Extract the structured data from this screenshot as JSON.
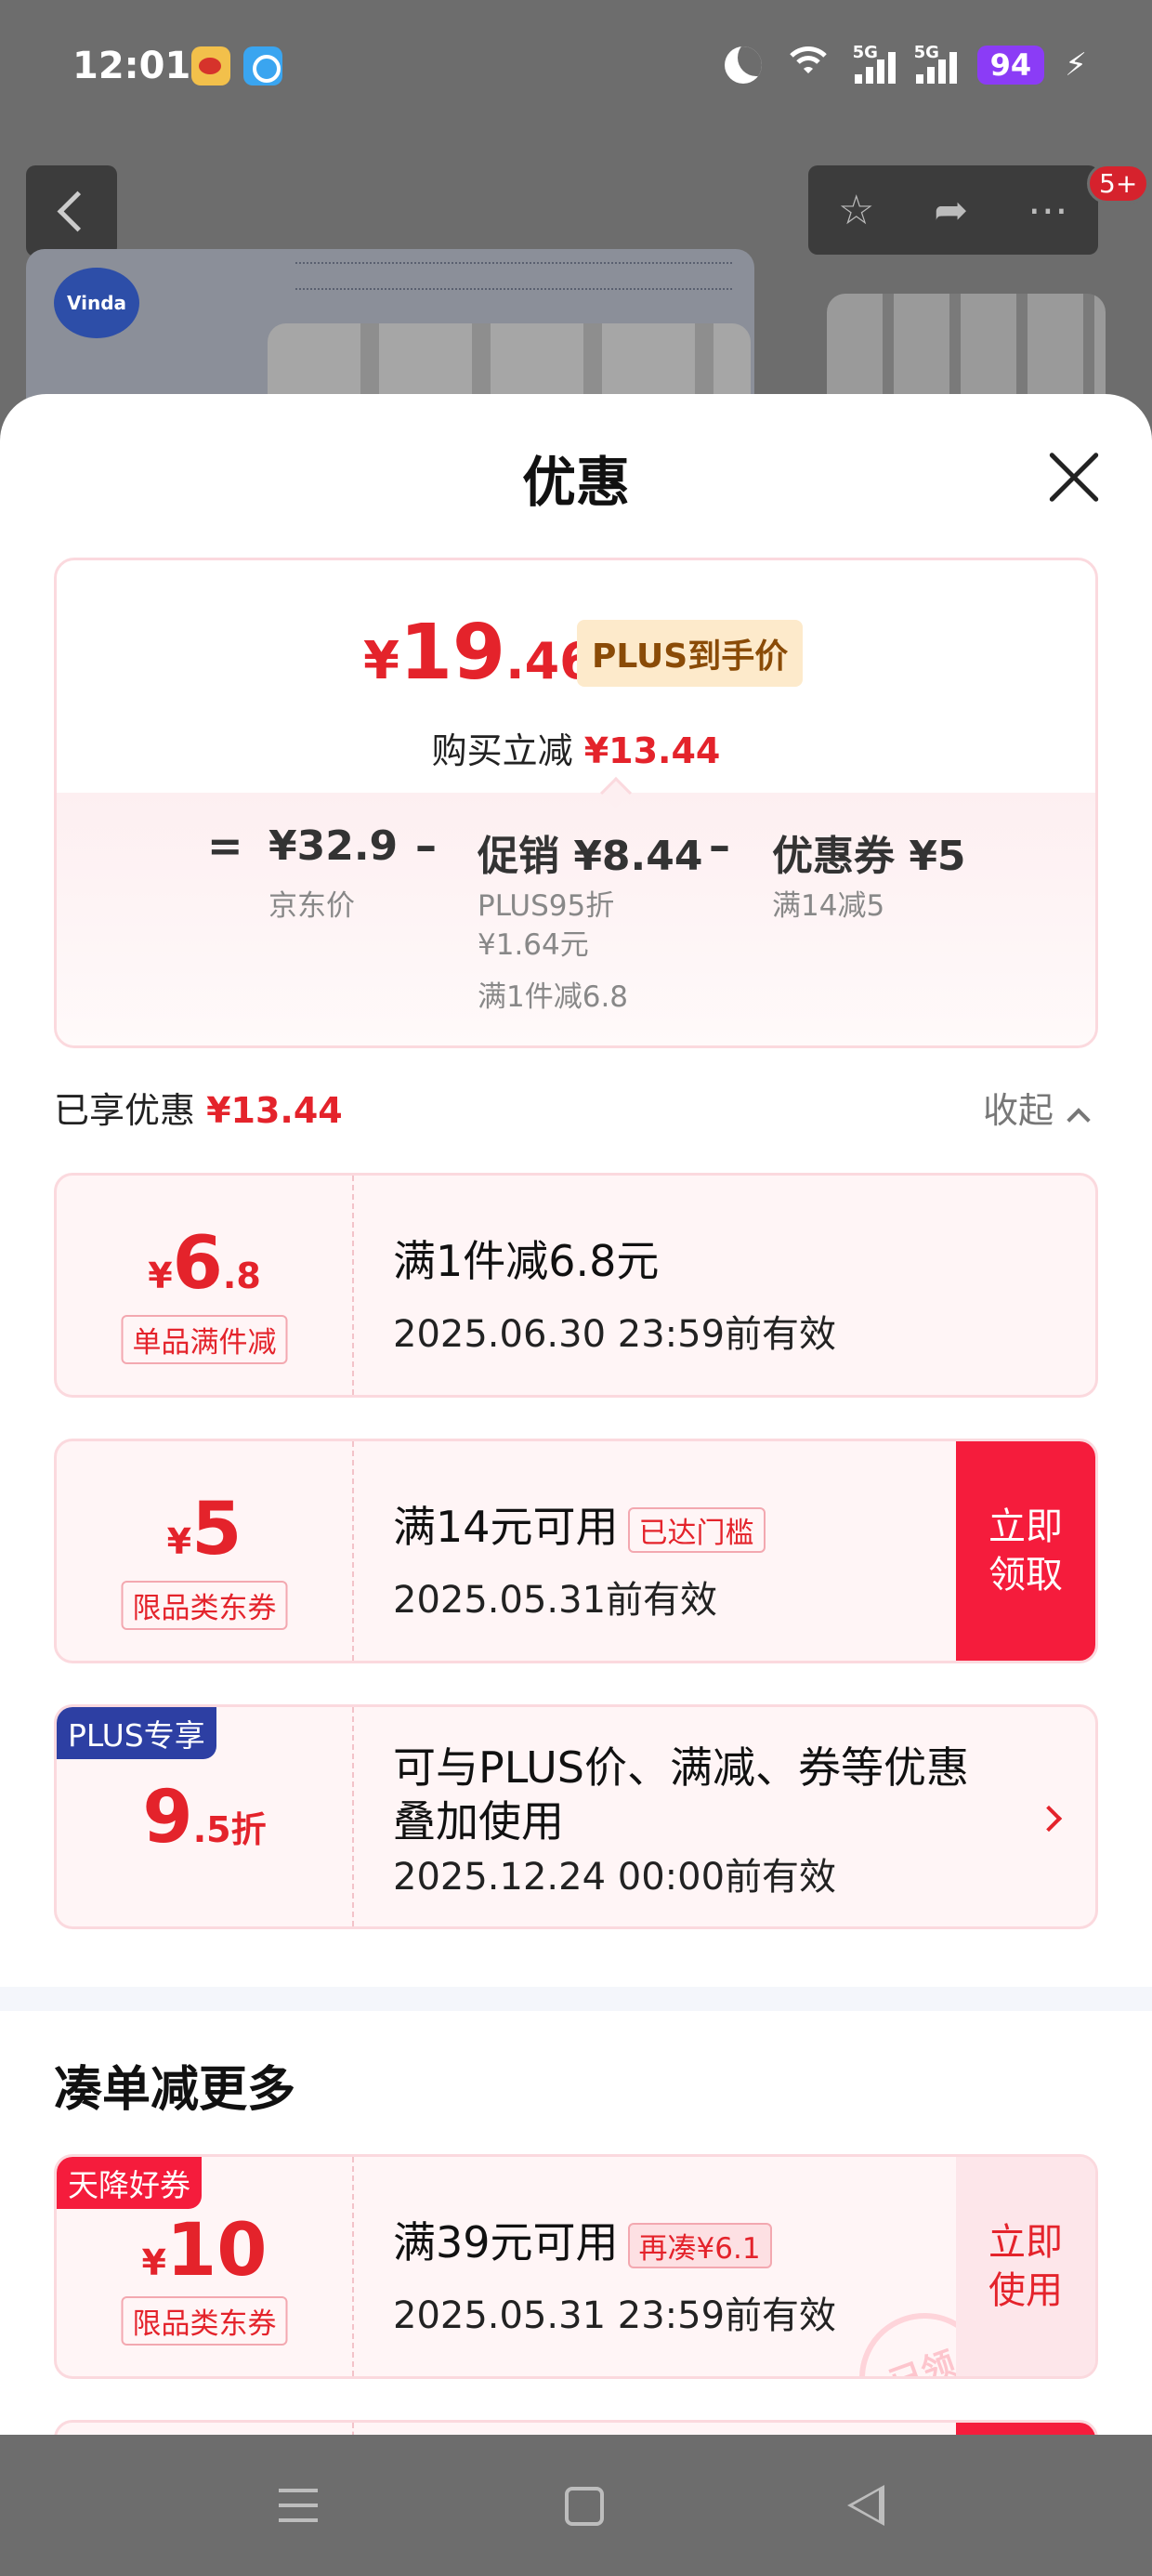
{
  "status_bar": {
    "time": "12:01",
    "battery": "94",
    "signal_1": "5G",
    "signal_2": "5G",
    "icons": [
      "weibo-app-icon",
      "qq-browser-icon",
      "moon-icon",
      "wifi-icon",
      "signal-icon",
      "battery-icon",
      "charging-icon"
    ]
  },
  "background_page": {
    "badge": "5+",
    "icons": [
      "back-icon",
      "star-icon",
      "share-icon",
      "more-icon"
    ],
    "logo_text": "Vinda"
  },
  "sheet": {
    "title": "优惠",
    "summary": {
      "final_currency": "¥",
      "final_int": "19",
      "final_dec": ".46",
      "plus_tag": "PLUS到手价",
      "reduce_label": "购买立减",
      "reduce_value": "¥13.44",
      "equals": "=",
      "minus": "–",
      "jd_price": "¥32.9",
      "jd_price_label": "京东价",
      "promo": "促销 ¥8.44",
      "promo_sub_1": "PLUS95折",
      "promo_sub_2": "¥1.64元",
      "promo_sub_3": "满1件减6.8",
      "coupon": "优惠券 ¥5",
      "coupon_sub": "满14减5"
    },
    "enjoyed_label": "已享优惠",
    "enjoyed_value": "¥13.44",
    "collapse_label": "收起",
    "coupons": [
      {
        "currency": "¥",
        "int": "6",
        "dec": ".8",
        "type": "单品满件减",
        "main": "满1件减6.8元",
        "valid": "2025.06.30 23:59前有效"
      },
      {
        "currency": "¥",
        "int": "5",
        "type": "限品类东券",
        "main": "满14元可用",
        "tag": "已达门槛",
        "valid": "2025.05.31前有效",
        "action": "立即领取"
      },
      {
        "corner_tag": "PLUS专享",
        "int": "9",
        "dec": ".5折",
        "main": "可与PLUS价、满减、券等优惠叠加使用",
        "valid": "2025.12.24 00:00前有效"
      }
    ],
    "more_section_title": "凑单减更多",
    "more_coupons": [
      {
        "corner_tag": "天降好券",
        "currency": "¥",
        "int": "10",
        "type": "限品类东券",
        "main": "满39元可用",
        "tag": "再凑¥6.1",
        "valid": "2025.05.31 23:59前有效",
        "action": "立即使用",
        "stamp": "已领"
      }
    ]
  },
  "nav_bar": {
    "icons": [
      "menu-icon",
      "home-icon",
      "back-icon"
    ]
  },
  "colors": {
    "accent_red": "#e4232b",
    "button_red": "#f51c3c",
    "plus_blue": "#2d3fa3",
    "plus_gold_bg": "#fdeacb"
  }
}
